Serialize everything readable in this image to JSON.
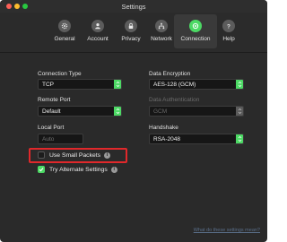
{
  "window": {
    "title": "Settings",
    "traffic_lights": {
      "close_color": "#fc5f57",
      "minimize_color": "#fdbc2e",
      "zoom_color": "#28c840"
    }
  },
  "tabs": [
    {
      "label": "General",
      "icon": "gear-icon",
      "active": false
    },
    {
      "label": "Account",
      "icon": "person-icon",
      "active": false
    },
    {
      "label": "Privacy",
      "icon": "lock-icon",
      "active": false
    },
    {
      "label": "Network",
      "icon": "network-icon",
      "active": false
    },
    {
      "label": "Connection",
      "icon": "connection-icon",
      "active": true
    },
    {
      "label": "Help",
      "icon": "question-icon",
      "active": false
    }
  ],
  "connection": {
    "connection_type": {
      "label": "Connection Type",
      "value": "TCP"
    },
    "remote_port": {
      "label": "Remote Port",
      "value": "Default"
    },
    "local_port": {
      "label": "Local Port",
      "placeholder": "Auto"
    },
    "data_encryption": {
      "label": "Data Encryption",
      "value": "AES-128 (GCM)"
    },
    "data_authentication": {
      "label": "Data Authentication",
      "value": "GCM",
      "disabled": true
    },
    "handshake": {
      "label": "Handshake",
      "value": "RSA-2048"
    },
    "use_small_packets": {
      "label": "Use Small Packets",
      "checked": false
    },
    "try_alternate_settings": {
      "label": "Try Alternate Settings",
      "checked": true
    }
  },
  "help_link": "What do these settings mean?",
  "colors": {
    "accent": "#4cd964",
    "highlight": "#e0282b",
    "background": "#2a2a2a"
  }
}
